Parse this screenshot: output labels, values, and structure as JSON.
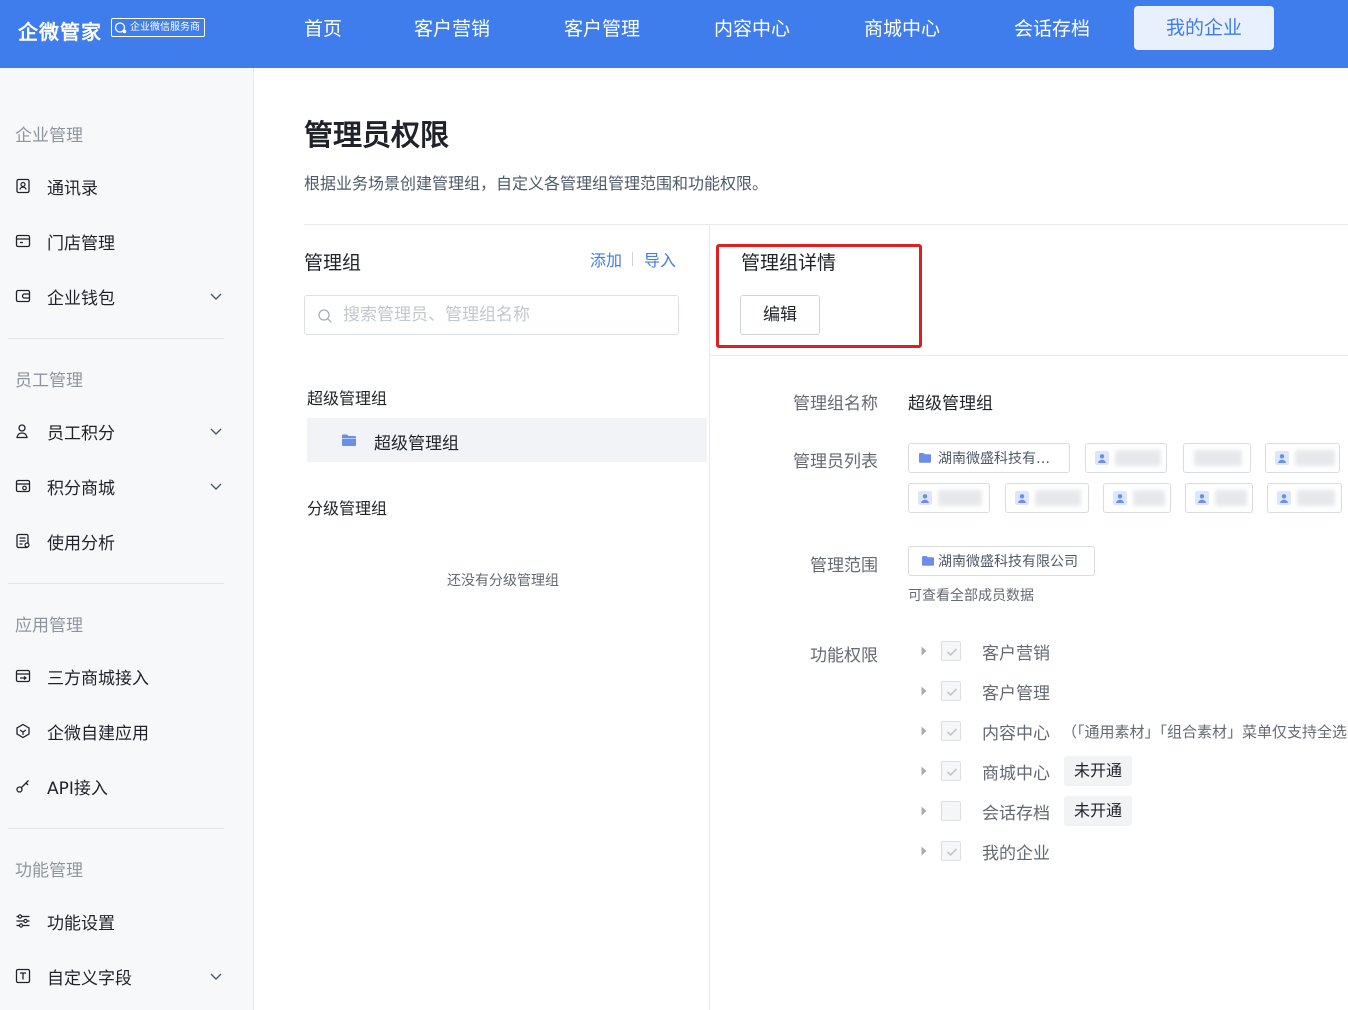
{
  "header": {
    "brand": "企微管家",
    "badge": "企业微信服务商",
    "nav": [
      "首页",
      "客户营销",
      "客户管理",
      "内容中心",
      "商城中心",
      "会话存档",
      "我的企业"
    ],
    "active_nav": "我的企业",
    "bg_color": "#3f7cec"
  },
  "sidebar": {
    "sections": [
      {
        "title": "企业管理",
        "items": [
          {
            "label": "通讯录",
            "icon": "contacts-icon",
            "expandable": false
          },
          {
            "label": "门店管理",
            "icon": "store-icon",
            "expandable": false
          },
          {
            "label": "企业钱包",
            "icon": "wallet-icon",
            "expandable": true
          }
        ]
      },
      {
        "title": "员工管理",
        "items": [
          {
            "label": "员工积分",
            "icon": "user-icon",
            "expandable": true
          },
          {
            "label": "积分商城",
            "icon": "mall-icon",
            "expandable": true
          },
          {
            "label": "使用分析",
            "icon": "analysis-icon",
            "expandable": false
          }
        ]
      },
      {
        "title": "应用管理",
        "items": [
          {
            "label": "三方商城接入",
            "icon": "connect-icon",
            "expandable": false
          },
          {
            "label": "企微自建应用",
            "icon": "app-icon",
            "expandable": false
          },
          {
            "label": "API接入",
            "icon": "key-icon",
            "expandable": false
          }
        ]
      },
      {
        "title": "功能管理",
        "items": [
          {
            "label": "功能设置",
            "icon": "sliders-icon",
            "expandable": false
          },
          {
            "label": "自定义字段",
            "icon": "text-field-icon",
            "expandable": true
          }
        ]
      }
    ]
  },
  "main": {
    "title": "管理员权限",
    "description": "根据业务场景创建管理组，自定义各管理组管理范围和功能权限。",
    "left_panel": {
      "title": "管理组",
      "add_label": "添加",
      "import_label": "导入",
      "search_placeholder": "搜索管理员、管理组名称",
      "super_group_label": "超级管理组",
      "super_group_item": "超级管理组",
      "sub_group_label": "分级管理组",
      "empty_text": "还没有分级管理组"
    },
    "right_panel": {
      "title": "管理组详情",
      "edit_label": "编辑",
      "name_label": "管理组名称",
      "name_value": "超级管理组",
      "admins_label": "管理员列表",
      "admin_first": "湖南微盛科技有…",
      "scope_label": "管理范围",
      "scope_value": "湖南微盛科技有限公司",
      "scope_note": "可查看全部成员数据",
      "perm_label": "功能权限",
      "permissions": [
        {
          "label": "客户营销",
          "checked": true,
          "note": "",
          "badge": ""
        },
        {
          "label": "客户管理",
          "checked": true,
          "note": "",
          "badge": ""
        },
        {
          "label": "内容中心",
          "checked": true,
          "note": "（「通用素材」「组合素材」菜单仅支持全选",
          "badge": ""
        },
        {
          "label": "商城中心",
          "checked": true,
          "note": "",
          "badge": "未开通"
        },
        {
          "label": "会话存档",
          "checked": false,
          "note": "",
          "badge": "未开通"
        },
        {
          "label": "我的企业",
          "checked": true,
          "note": "",
          "badge": ""
        }
      ]
    }
  }
}
